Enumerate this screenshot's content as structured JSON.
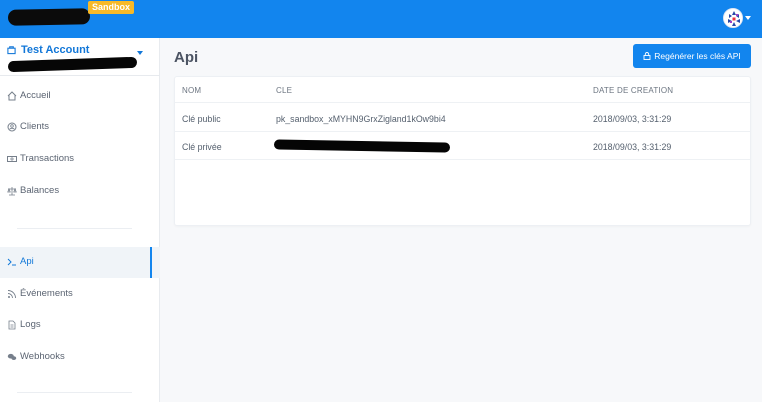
{
  "topbar": {
    "badge": "Sandbox",
    "colors": {
      "bar": "#1285ee",
      "badge": "#f7b928"
    }
  },
  "sidebar": {
    "account_name": "Test Account",
    "items": [
      {
        "label": "Accueil",
        "icon": "home-icon"
      },
      {
        "label": "Clients",
        "icon": "user-icon"
      },
      {
        "label": "Transactions",
        "icon": "banknote-icon"
      },
      {
        "label": "Balances",
        "icon": "scale-icon"
      },
      {
        "label": "Api",
        "icon": "terminal-icon",
        "active": true
      },
      {
        "label": "Événements",
        "icon": "rss-icon"
      },
      {
        "label": "Logs",
        "icon": "document-icon"
      },
      {
        "label": "Webhooks",
        "icon": "chat-icon"
      }
    ]
  },
  "main": {
    "title": "Api",
    "regenerate_button": "Regénérer les clés API",
    "table": {
      "headers": [
        "NOM",
        "CLE",
        "DATE DE CREATION"
      ],
      "rows": [
        {
          "name": "Clé public",
          "key": "pk_sandbox_xMYHN9GrxZigland1kOw9bi4",
          "date": "2018/09/03, 3:31:29"
        },
        {
          "name": "Clé privée",
          "key": "",
          "date": "2018/09/03, 3:31:29"
        }
      ]
    }
  }
}
